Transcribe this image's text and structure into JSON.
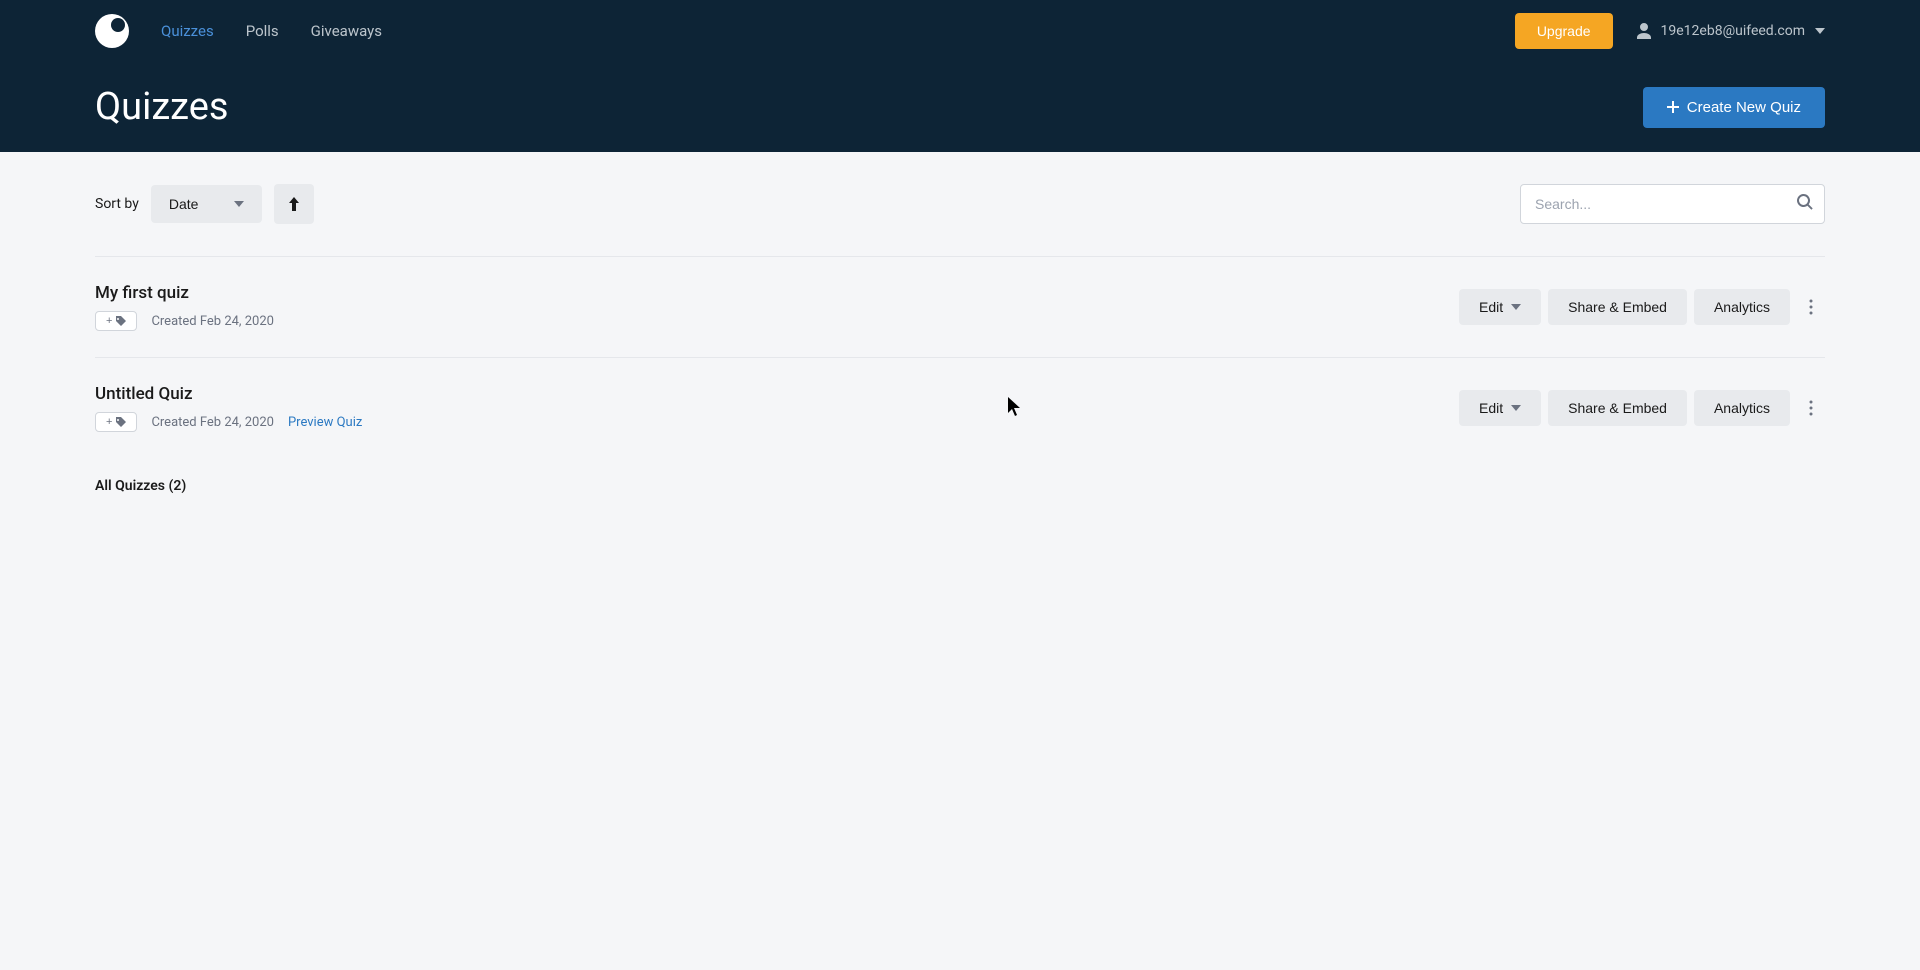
{
  "nav": {
    "quizzes": "Quizzes",
    "polls": "Polls",
    "giveaways": "Giveaways",
    "upgrade": "Upgrade",
    "user_email": "19e12eb8@uifeed.com"
  },
  "page": {
    "title": "Quizzes",
    "create_btn": "Create New Quiz"
  },
  "filter": {
    "sort_label": "Sort by",
    "sort_value": "Date",
    "search_placeholder": "Search..."
  },
  "actions": {
    "edit": "Edit",
    "share": "Share & Embed",
    "analytics": "Analytics",
    "preview": "Preview Quiz",
    "tag_add": "+"
  },
  "quizzes": [
    {
      "title": "My first quiz",
      "created": "Created Feb 24, 2020",
      "has_preview": false
    },
    {
      "title": "Untitled Quiz",
      "created": "Created Feb 24, 2020",
      "has_preview": true
    }
  ],
  "footer": {
    "count": "All Quizzes (2)"
  }
}
